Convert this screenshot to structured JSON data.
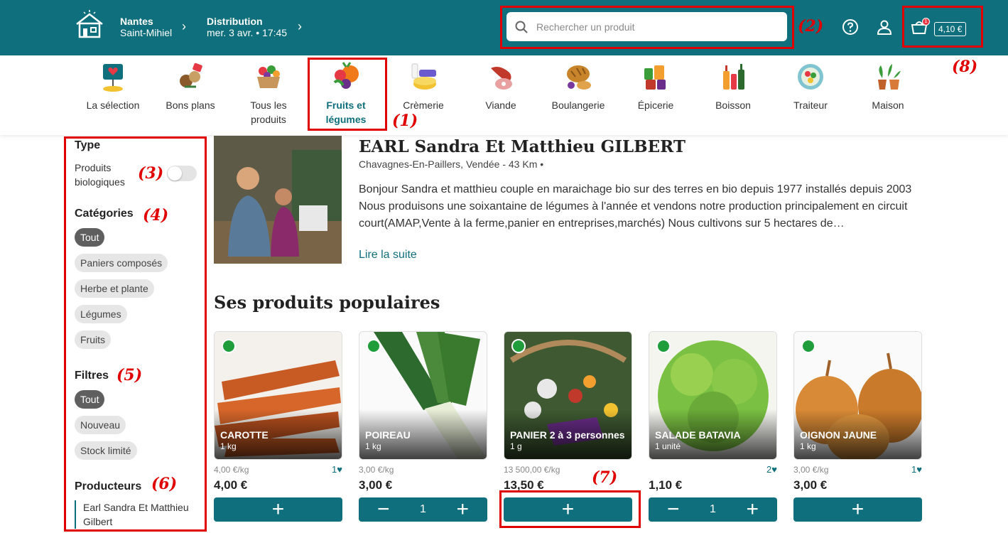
{
  "header": {
    "location_city": "Nantes",
    "location_place": "Saint-Mihiel",
    "distribution_label": "Distribution",
    "distribution_date": "mer. 3 avr. • 17:45",
    "search_placeholder": "Rechercher un produit",
    "cart_total": "4,10 €",
    "cart_count": "1"
  },
  "categories": [
    {
      "line1": "La sélection",
      "line2": ""
    },
    {
      "line1": "Bons plans",
      "line2": ""
    },
    {
      "line1": "Tous les",
      "line2": "produits"
    },
    {
      "line1": "Fruits et",
      "line2": "légumes"
    },
    {
      "line1": "Crèmerie",
      "line2": ""
    },
    {
      "line1": "Viande",
      "line2": ""
    },
    {
      "line1": "Boulangerie",
      "line2": ""
    },
    {
      "line1": "Épicerie",
      "line2": ""
    },
    {
      "line1": "Boisson",
      "line2": ""
    },
    {
      "line1": "Traiteur",
      "line2": ""
    },
    {
      "line1": "Maison",
      "line2": ""
    }
  ],
  "sidebar": {
    "type_heading": "Type",
    "bio_label_1": "Produits",
    "bio_label_2": "biologiques",
    "categories_heading": "Catégories",
    "category_pills": [
      "Tout",
      "Paniers composés",
      "Herbe et plante",
      "Légumes",
      "Fruits"
    ],
    "filters_heading": "Filtres",
    "filter_pills": [
      "Tout",
      "Nouveau",
      "Stock limité"
    ],
    "producers_heading": "Producteurs",
    "producer_1": "Earl Sandra Et Matthieu",
    "producer_2": "Gilbert"
  },
  "producer": {
    "name": "EARL Sandra Et Matthieu GILBERT",
    "location": "Chavagnes-En-Paillers, Vendée - 43 Km •",
    "description": "Bonjour Sandra et matthieu couple en maraichage bio sur des terres en bio depuis 1977 installés depuis 2003 Nous produisons une soixantaine de légumes à l'année et vendons notre production principalement en circuit court(AMAP,Vente à la ferme,panier en entreprises,marchés) Nous cultivons sur 5 hectares de…",
    "read_more": "Lire la suite"
  },
  "products_title": "Ses produits populaires",
  "products": [
    {
      "name": "CAROTTE",
      "qty": "1 kg",
      "unit_price": "4,00 €/kg",
      "likes": "1",
      "price": "4,00 €",
      "in_cart": ""
    },
    {
      "name": "POIREAU",
      "qty": "1 kg",
      "unit_price": "3,00 €/kg",
      "likes": "",
      "price": "3,00 €",
      "in_cart": "1"
    },
    {
      "name": "PANIER 2 à 3 personnes",
      "qty": "1 g",
      "unit_price": "13 500,00 €/kg",
      "likes": "",
      "price": "13,50 €",
      "in_cart": ""
    },
    {
      "name": "SALADE BATAVIA",
      "qty": "1 unité",
      "unit_price": "",
      "likes": "2",
      "price": "1,10 €",
      "in_cart": "1"
    },
    {
      "name": "OIGNON JAUNE",
      "qty": "1 kg",
      "unit_price": "3,00 €/kg",
      "likes": "1",
      "price": "3,00 €",
      "in_cart": ""
    }
  ],
  "annotations": [
    "(1)",
    "(2)",
    "(3)",
    "(4)",
    "(5)",
    "(6)",
    "(7)",
    "(8)"
  ],
  "colors": {
    "brand": "#0f6f7d",
    "annotation": "#e00000",
    "bio": "#1f9d3b"
  }
}
